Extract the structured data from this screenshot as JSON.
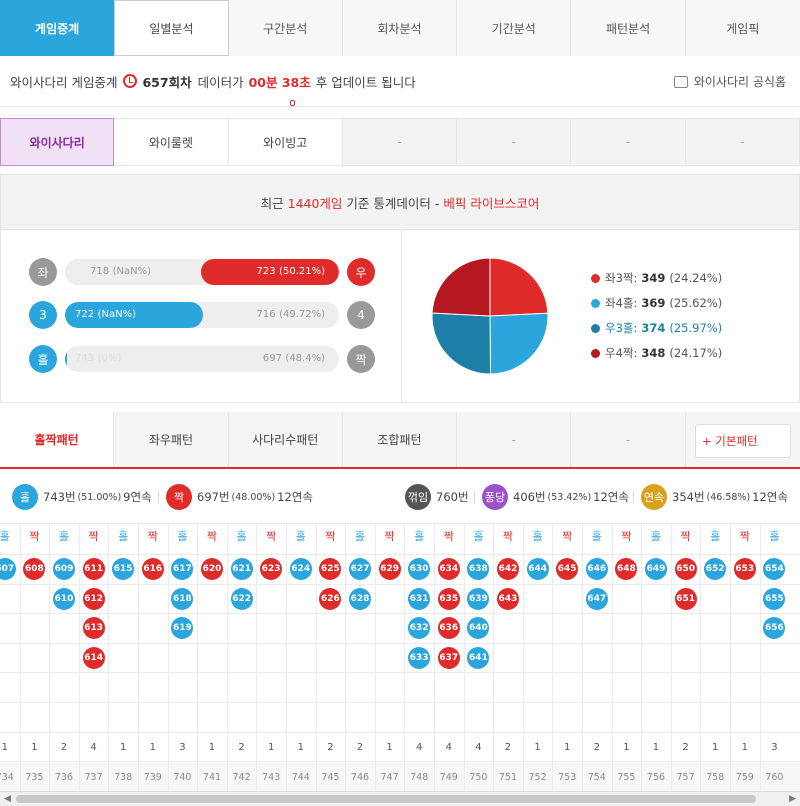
{
  "top_tabs": [
    "게임중계",
    "일별분석",
    "구간분석",
    "회차분석",
    "기간분석",
    "패턴분석",
    "게임픽"
  ],
  "info": {
    "prefix": "와이사다리 게임중계",
    "round": "657회차",
    "mid": "데이터가",
    "time": "00분 38초",
    "suffix": "후 업데이트 됩니다",
    "official": "와이사다리 공식홈"
  },
  "game_tabs": [
    "와이사다리",
    "와이룰렛",
    "와이빙고",
    "-",
    "-",
    "-",
    "-"
  ],
  "stats": {
    "head_a": "최근",
    "head_count": "1440게임",
    "head_b": "기준 통계데이터 -",
    "head_site": "베픽 라이브스코어",
    "rows": [
      {
        "left_label": "좌",
        "left_value": "718",
        "left_pct": "(NaN%)",
        "right_value": "723",
        "right_pct": "(50.21%)",
        "right_label": "우",
        "fill_fraction": 0.5021
      },
      {
        "left_label": "3",
        "left_value": "722",
        "left_pct": "(NaN%)",
        "right_value": "716",
        "right_pct": "(49.72%)",
        "right_label": "4",
        "fill_fraction": 0.5028
      },
      {
        "left_label": "홀",
        "left_value": "743",
        "left_pct": "(0%)",
        "right_value": "697",
        "right_pct": "(48.4%)",
        "right_label": "짝",
        "fill_fraction": 0.0
      }
    ],
    "legend": [
      {
        "label": "좌3짝",
        "value": "349",
        "pct": "(24.24%)",
        "color": "#e02b2b"
      },
      {
        "label": "좌4홀",
        "value": "369",
        "pct": "(25.62%)",
        "color": "#2aa6dc"
      },
      {
        "label": "우3홀",
        "value": "374",
        "pct": "(25.97%)",
        "color": "#1d7fa8"
      },
      {
        "label": "우4짝",
        "value": "348",
        "pct": "(24.17%)",
        "color": "#b5181e"
      }
    ],
    "pie": [
      24.24,
      25.62,
      25.97,
      24.17
    ]
  },
  "pattern_tabs": [
    "홀짝패턴",
    "좌우패턴",
    "사다리수패턴",
    "조합패턴",
    "-",
    "-"
  ],
  "basic_button": "+ 기본패턴",
  "summary": {
    "odd": {
      "label": "홀",
      "count": "743번",
      "pct": "(51.00%)",
      "streak": "9연속"
    },
    "even": {
      "label": "짝",
      "count": "697번",
      "pct": "(48.00%)",
      "streak": "12연속"
    },
    "bounce": {
      "label": "꺾임",
      "count": "760번"
    },
    "pong": {
      "label": "퐁당",
      "count": "406번",
      "pct": "(53.42%)",
      "streak": "12연속"
    },
    "cont": {
      "label": "연속",
      "count": "354번",
      "pct": "(46.58%)",
      "streak": "12연속"
    }
  },
  "grid": {
    "odd_label": "홀",
    "even_label": "짝",
    "columns": [
      {
        "type": "odd",
        "balls": [
          "607"
        ],
        "count": "1",
        "round": "734"
      },
      {
        "type": "even",
        "balls": [
          "608"
        ],
        "count": "1",
        "round": "735"
      },
      {
        "type": "odd",
        "balls": [
          "609",
          "610"
        ],
        "count": "2",
        "round": "736"
      },
      {
        "type": "even",
        "balls": [
          "611",
          "612",
          "613",
          "614"
        ],
        "count": "4",
        "round": "737"
      },
      {
        "type": "odd",
        "balls": [
          "615"
        ],
        "count": "1",
        "round": "738"
      },
      {
        "type": "even",
        "balls": [
          "616"
        ],
        "count": "1",
        "round": "739"
      },
      {
        "type": "odd",
        "balls": [
          "617",
          "618",
          "619"
        ],
        "count": "3",
        "round": "740"
      },
      {
        "type": "even",
        "balls": [
          "620"
        ],
        "count": "1",
        "round": "741"
      },
      {
        "type": "odd",
        "balls": [
          "621",
          "622"
        ],
        "count": "2",
        "round": "742"
      },
      {
        "type": "even",
        "balls": [
          "623"
        ],
        "count": "1",
        "round": "743"
      },
      {
        "type": "odd",
        "balls": [
          "624"
        ],
        "count": "1",
        "round": "744"
      },
      {
        "type": "even",
        "balls": [
          "625",
          "626"
        ],
        "count": "2",
        "round": "745"
      },
      {
        "type": "odd",
        "balls": [
          "627",
          "628"
        ],
        "count": "2",
        "round": "746"
      },
      {
        "type": "even",
        "balls": [
          "629"
        ],
        "count": "1",
        "round": "747"
      },
      {
        "type": "odd",
        "balls": [
          "630",
          "631",
          "632",
          "633"
        ],
        "count": "4",
        "round": "748"
      },
      {
        "type": "even",
        "balls": [
          "634",
          "635",
          "636",
          "637"
        ],
        "count": "4",
        "round": "749"
      },
      {
        "type": "odd",
        "balls": [
          "638",
          "639",
          "640",
          "641"
        ],
        "count": "4",
        "round": "750"
      },
      {
        "type": "even",
        "balls": [
          "642",
          "643"
        ],
        "count": "2",
        "round": "751"
      },
      {
        "type": "odd",
        "balls": [
          "644"
        ],
        "count": "1",
        "round": "752"
      },
      {
        "type": "even",
        "balls": [
          "645"
        ],
        "count": "1",
        "round": "753"
      },
      {
        "type": "odd",
        "balls": [
          "646",
          "647"
        ],
        "count": "2",
        "round": "754"
      },
      {
        "type": "even",
        "balls": [
          "648"
        ],
        "count": "1",
        "round": "755"
      },
      {
        "type": "odd",
        "balls": [
          "649"
        ],
        "count": "1",
        "round": "756"
      },
      {
        "type": "even",
        "balls": [
          "650",
          "651"
        ],
        "count": "2",
        "round": "757"
      },
      {
        "type": "odd",
        "balls": [
          "652"
        ],
        "count": "1",
        "round": "758"
      },
      {
        "type": "even",
        "balls": [
          "653"
        ],
        "count": "1",
        "round": "759"
      },
      {
        "type": "odd",
        "balls": [
          "654",
          "655",
          "656"
        ],
        "count": "3",
        "round": "760"
      }
    ]
  }
}
